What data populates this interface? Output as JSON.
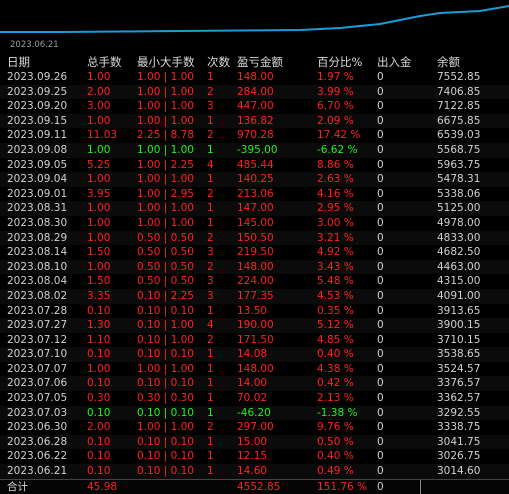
{
  "chart": {
    "date_label": "2023.06.21",
    "line_color": "#1e9bd7"
  },
  "colors": {
    "loss": "#ff2020",
    "profit": "#22ee22"
  },
  "columns": [
    "日期",
    "总手数",
    "最小大手数",
    "次数",
    "盈亏金额",
    "百分比%",
    "出入金",
    "余额"
  ],
  "rows": [
    {
      "date": "2023.09.26",
      "lots": "1.00",
      "minmax": "1.00 | 1.00",
      "count": "1",
      "pnl": "148.00",
      "pct": "1.97 %",
      "flow": "0",
      "balance": "7552.85",
      "type": "loss"
    },
    {
      "date": "2023.09.25",
      "lots": "2.00",
      "minmax": "1.00 | 1.00",
      "count": "2",
      "pnl": "284.00",
      "pct": "3.99 %",
      "flow": "0",
      "balance": "7406.85",
      "type": "loss"
    },
    {
      "date": "2023.09.20",
      "lots": "3.00",
      "minmax": "1.00 | 1.00",
      "count": "3",
      "pnl": "447.00",
      "pct": "6.70 %",
      "flow": "0",
      "balance": "7122.85",
      "type": "loss"
    },
    {
      "date": "2023.09.15",
      "lots": "1.00",
      "minmax": "1.00 | 1.00",
      "count": "1",
      "pnl": "136.82",
      "pct": "2.09 %",
      "flow": "0",
      "balance": "6675.85",
      "type": "loss"
    },
    {
      "date": "2023.09.11",
      "lots": "11.03",
      "minmax": "2.25 | 8.78",
      "count": "2",
      "pnl": "970.28",
      "pct": "17.42 %",
      "flow": "0",
      "balance": "6539.03",
      "type": "loss"
    },
    {
      "date": "2023.09.08",
      "lots": "1.00",
      "minmax": "1.00 | 1.00",
      "count": "1",
      "pnl": "-395.00",
      "pct": "-6.62 %",
      "flow": "0",
      "balance": "5568.75",
      "type": "profit"
    },
    {
      "date": "2023.09.05",
      "lots": "5.25",
      "minmax": "1.00 | 2.25",
      "count": "4",
      "pnl": "485.44",
      "pct": "8.86 %",
      "flow": "0",
      "balance": "5963.75",
      "type": "loss"
    },
    {
      "date": "2023.09.04",
      "lots": "1.00",
      "minmax": "1.00 | 1.00",
      "count": "1",
      "pnl": "140.25",
      "pct": "2.63 %",
      "flow": "0",
      "balance": "5478.31",
      "type": "loss"
    },
    {
      "date": "2023.09.01",
      "lots": "3.95",
      "minmax": "1.00 | 2.95",
      "count": "2",
      "pnl": "213.06",
      "pct": "4.16 %",
      "flow": "0",
      "balance": "5338.06",
      "type": "loss"
    },
    {
      "date": "2023.08.31",
      "lots": "1.00",
      "minmax": "1.00 | 1.00",
      "count": "1",
      "pnl": "147.00",
      "pct": "2.95 %",
      "flow": "0",
      "balance": "5125.00",
      "type": "loss"
    },
    {
      "date": "2023.08.30",
      "lots": "1.00",
      "minmax": "1.00 | 1.00",
      "count": "1",
      "pnl": "145.00",
      "pct": "3.00 %",
      "flow": "0",
      "balance": "4978.00",
      "type": "loss"
    },
    {
      "date": "2023.08.29",
      "lots": "1.00",
      "minmax": "0.50 | 0.50",
      "count": "2",
      "pnl": "150.50",
      "pct": "3.21 %",
      "flow": "0",
      "balance": "4833.00",
      "type": "loss"
    },
    {
      "date": "2023.08.14",
      "lots": "1.50",
      "minmax": "0.50 | 0.50",
      "count": "3",
      "pnl": "219.50",
      "pct": "4.92 %",
      "flow": "0",
      "balance": "4682.50",
      "type": "loss"
    },
    {
      "date": "2023.08.10",
      "lots": "1.00",
      "minmax": "0.50 | 0.50",
      "count": "2",
      "pnl": "148.00",
      "pct": "3.43 %",
      "flow": "0",
      "balance": "4463.00",
      "type": "loss"
    },
    {
      "date": "2023.08.04",
      "lots": "1.50",
      "minmax": "0.50 | 0.50",
      "count": "3",
      "pnl": "224.00",
      "pct": "5.48 %",
      "flow": "0",
      "balance": "4315.00",
      "type": "loss"
    },
    {
      "date": "2023.08.02",
      "lots": "3.35",
      "minmax": "0.10 | 2.25",
      "count": "3",
      "pnl": "177.35",
      "pct": "4.53 %",
      "flow": "0",
      "balance": "4091.00",
      "type": "loss"
    },
    {
      "date": "2023.07.28",
      "lots": "0.10",
      "minmax": "0.10 | 0.10",
      "count": "1",
      "pnl": "13.50",
      "pct": "0.35 %",
      "flow": "0",
      "balance": "3913.65",
      "type": "loss"
    },
    {
      "date": "2023.07.27",
      "lots": "1.30",
      "minmax": "0.10 | 1.00",
      "count": "4",
      "pnl": "190.00",
      "pct": "5.12 %",
      "flow": "0",
      "balance": "3900.15",
      "type": "loss"
    },
    {
      "date": "2023.07.12",
      "lots": "1.10",
      "minmax": "0.10 | 1.00",
      "count": "2",
      "pnl": "171.50",
      "pct": "4.85 %",
      "flow": "0",
      "balance": "3710.15",
      "type": "loss"
    },
    {
      "date": "2023.07.10",
      "lots": "0.10",
      "minmax": "0.10 | 0.10",
      "count": "1",
      "pnl": "14.08",
      "pct": "0.40 %",
      "flow": "0",
      "balance": "3538.65",
      "type": "loss"
    },
    {
      "date": "2023.07.07",
      "lots": "1.00",
      "minmax": "1.00 | 1.00",
      "count": "1",
      "pnl": "148.00",
      "pct": "4.38 %",
      "flow": "0",
      "balance": "3524.57",
      "type": "loss"
    },
    {
      "date": "2023.07.06",
      "lots": "0.10",
      "minmax": "0.10 | 0.10",
      "count": "1",
      "pnl": "14.00",
      "pct": "0.42 %",
      "flow": "0",
      "balance": "3376.57",
      "type": "loss"
    },
    {
      "date": "2023.07.05",
      "lots": "0.30",
      "minmax": "0.30 | 0.30",
      "count": "1",
      "pnl": "70.02",
      "pct": "2.13 %",
      "flow": "0",
      "balance": "3362.57",
      "type": "loss"
    },
    {
      "date": "2023.07.03",
      "lots": "0.10",
      "minmax": "0.10 | 0.10",
      "count": "1",
      "pnl": "-46.20",
      "pct": "-1.38 %",
      "flow": "0",
      "balance": "3292.55",
      "type": "profit"
    },
    {
      "date": "2023.06.30",
      "lots": "2.00",
      "minmax": "1.00 | 1.00",
      "count": "2",
      "pnl": "297.00",
      "pct": "9.76 %",
      "flow": "0",
      "balance": "3338.75",
      "type": "loss"
    },
    {
      "date": "2023.06.28",
      "lots": "0.10",
      "minmax": "0.10 | 0.10",
      "count": "1",
      "pnl": "15.00",
      "pct": "0.50 %",
      "flow": "0",
      "balance": "3041.75",
      "type": "loss"
    },
    {
      "date": "2023.06.22",
      "lots": "0.10",
      "minmax": "0.10 | 0.10",
      "count": "1",
      "pnl": "12.15",
      "pct": "0.40 %",
      "flow": "0",
      "balance": "3026.75",
      "type": "loss"
    },
    {
      "date": "2023.06.21",
      "lots": "0.10",
      "minmax": "0.10 | 0.10",
      "count": "1",
      "pnl": "14.60",
      "pct": "0.49 %",
      "flow": "0",
      "balance": "3014.60",
      "type": "loss"
    }
  ],
  "total": {
    "label": "合计",
    "lots": "45.98",
    "pnl": "4552.85",
    "pct": "151.76 %",
    "flow": "0"
  }
}
